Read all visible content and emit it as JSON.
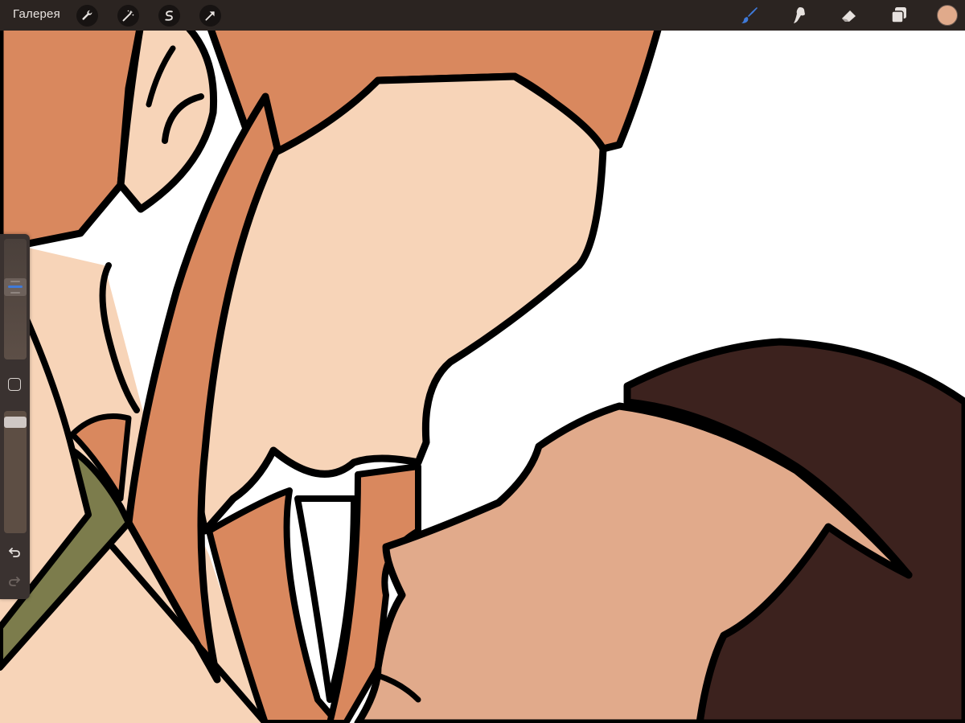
{
  "topbar": {
    "gallery_label": "Галерея",
    "left_tools": [
      {
        "name": "actions-wrench-icon"
      },
      {
        "name": "adjustments-magic-wand-icon"
      },
      {
        "name": "selection-s-icon"
      },
      {
        "name": "transform-arrow-icon"
      }
    ],
    "right_tools": [
      {
        "name": "brush-icon",
        "active": true
      },
      {
        "name": "smudge-icon"
      },
      {
        "name": "eraser-icon"
      },
      {
        "name": "layers-icon"
      }
    ],
    "current_color": "#e0aa8b"
  },
  "sidebar": {
    "brush_size_level": 0.62,
    "opacity_level": 0.05,
    "undo_icon": "undo-arrow-icon",
    "redo_icon": "redo-arrow-icon"
  },
  "canvas": {
    "palette": {
      "outline": "#000000",
      "hair": "#d9885e",
      "skin_light": "#f7d4b8",
      "skin_dark": "#e1aa8b",
      "dark_brown": "#3c221e",
      "olive": "#7c7c4c",
      "background": "#ffffff"
    }
  }
}
